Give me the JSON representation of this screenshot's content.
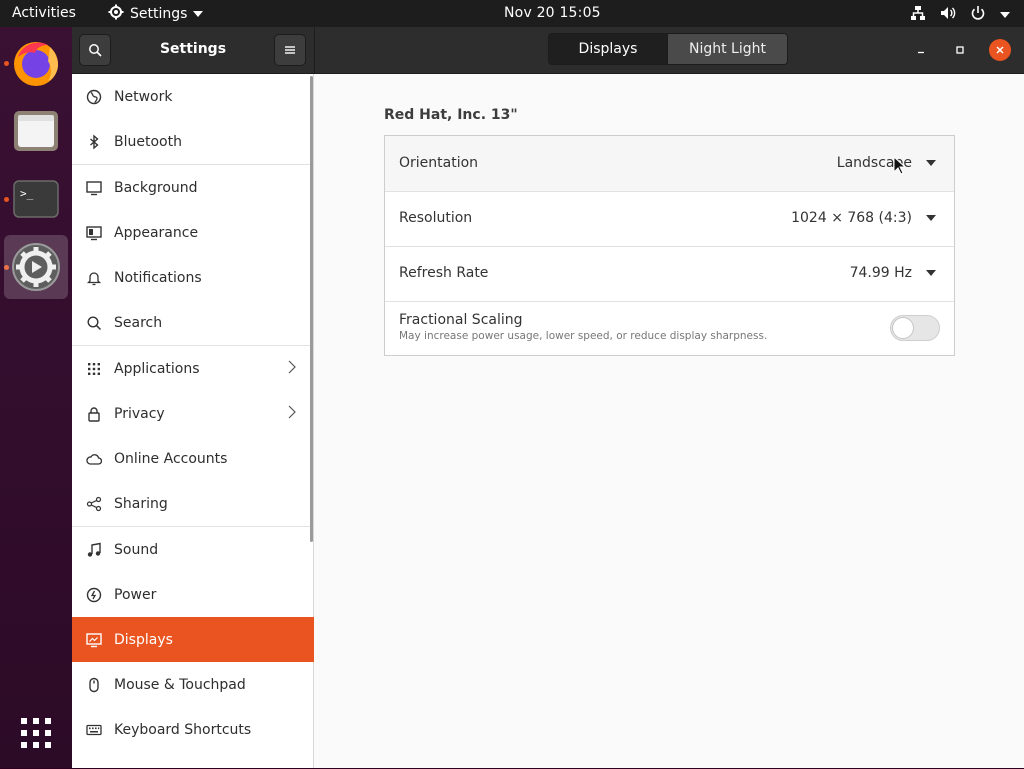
{
  "topbar": {
    "activities": "Activities",
    "app_menu": "Settings",
    "clock": "Nov 20  15:05",
    "tray_icons": [
      "network-icon",
      "volume-icon",
      "power-icon"
    ]
  },
  "dock": {
    "apps": [
      "firefox-icon",
      "files-icon",
      "terminal-icon",
      "settings-icon",
      "show-apps-icon"
    ],
    "terminal_prompt": ">_"
  },
  "headerbar": {
    "title": "Settings",
    "tabs": [
      {
        "label": "Displays",
        "selected": true
      },
      {
        "label": "Night Light",
        "selected": false
      }
    ],
    "close_color": "#e95420"
  },
  "sidebar": {
    "items": [
      {
        "label": "Network",
        "icon": "globe-icon"
      },
      {
        "label": "Bluetooth",
        "icon": "bluetooth-icon"
      },
      {
        "label": "Background",
        "icon": "monitor-icon"
      },
      {
        "label": "Appearance",
        "icon": "appearance-icon"
      },
      {
        "label": "Notifications",
        "icon": "bell-icon"
      },
      {
        "label": "Search",
        "icon": "search-icon"
      },
      {
        "label": "Applications",
        "icon": "grid-icon",
        "submenu": true
      },
      {
        "label": "Privacy",
        "icon": "lock-icon",
        "submenu": true
      },
      {
        "label": "Online Accounts",
        "icon": "cloud-icon"
      },
      {
        "label": "Sharing",
        "icon": "share-icon"
      },
      {
        "label": "Sound",
        "icon": "music-note-icon"
      },
      {
        "label": "Power",
        "icon": "power-icon"
      },
      {
        "label": "Displays",
        "icon": "display-icon",
        "selected": true
      },
      {
        "label": "Mouse & Touchpad",
        "icon": "mouse-icon"
      },
      {
        "label": "Keyboard Shortcuts",
        "icon": "keyboard-icon"
      }
    ],
    "accent_color": "#e95420"
  },
  "main": {
    "display_name": "Red Hat, Inc. 13\"",
    "rows": [
      {
        "label": "Orientation",
        "value": "Landscape"
      },
      {
        "label": "Resolution",
        "value": "1024 × 768 (4:3)"
      },
      {
        "label": "Refresh Rate",
        "value": "74.99 Hz"
      }
    ],
    "fractional_scaling": {
      "label": "Fractional Scaling",
      "description": "May increase power usage, lower speed, or reduce display sharpness.",
      "enabled": false
    }
  }
}
